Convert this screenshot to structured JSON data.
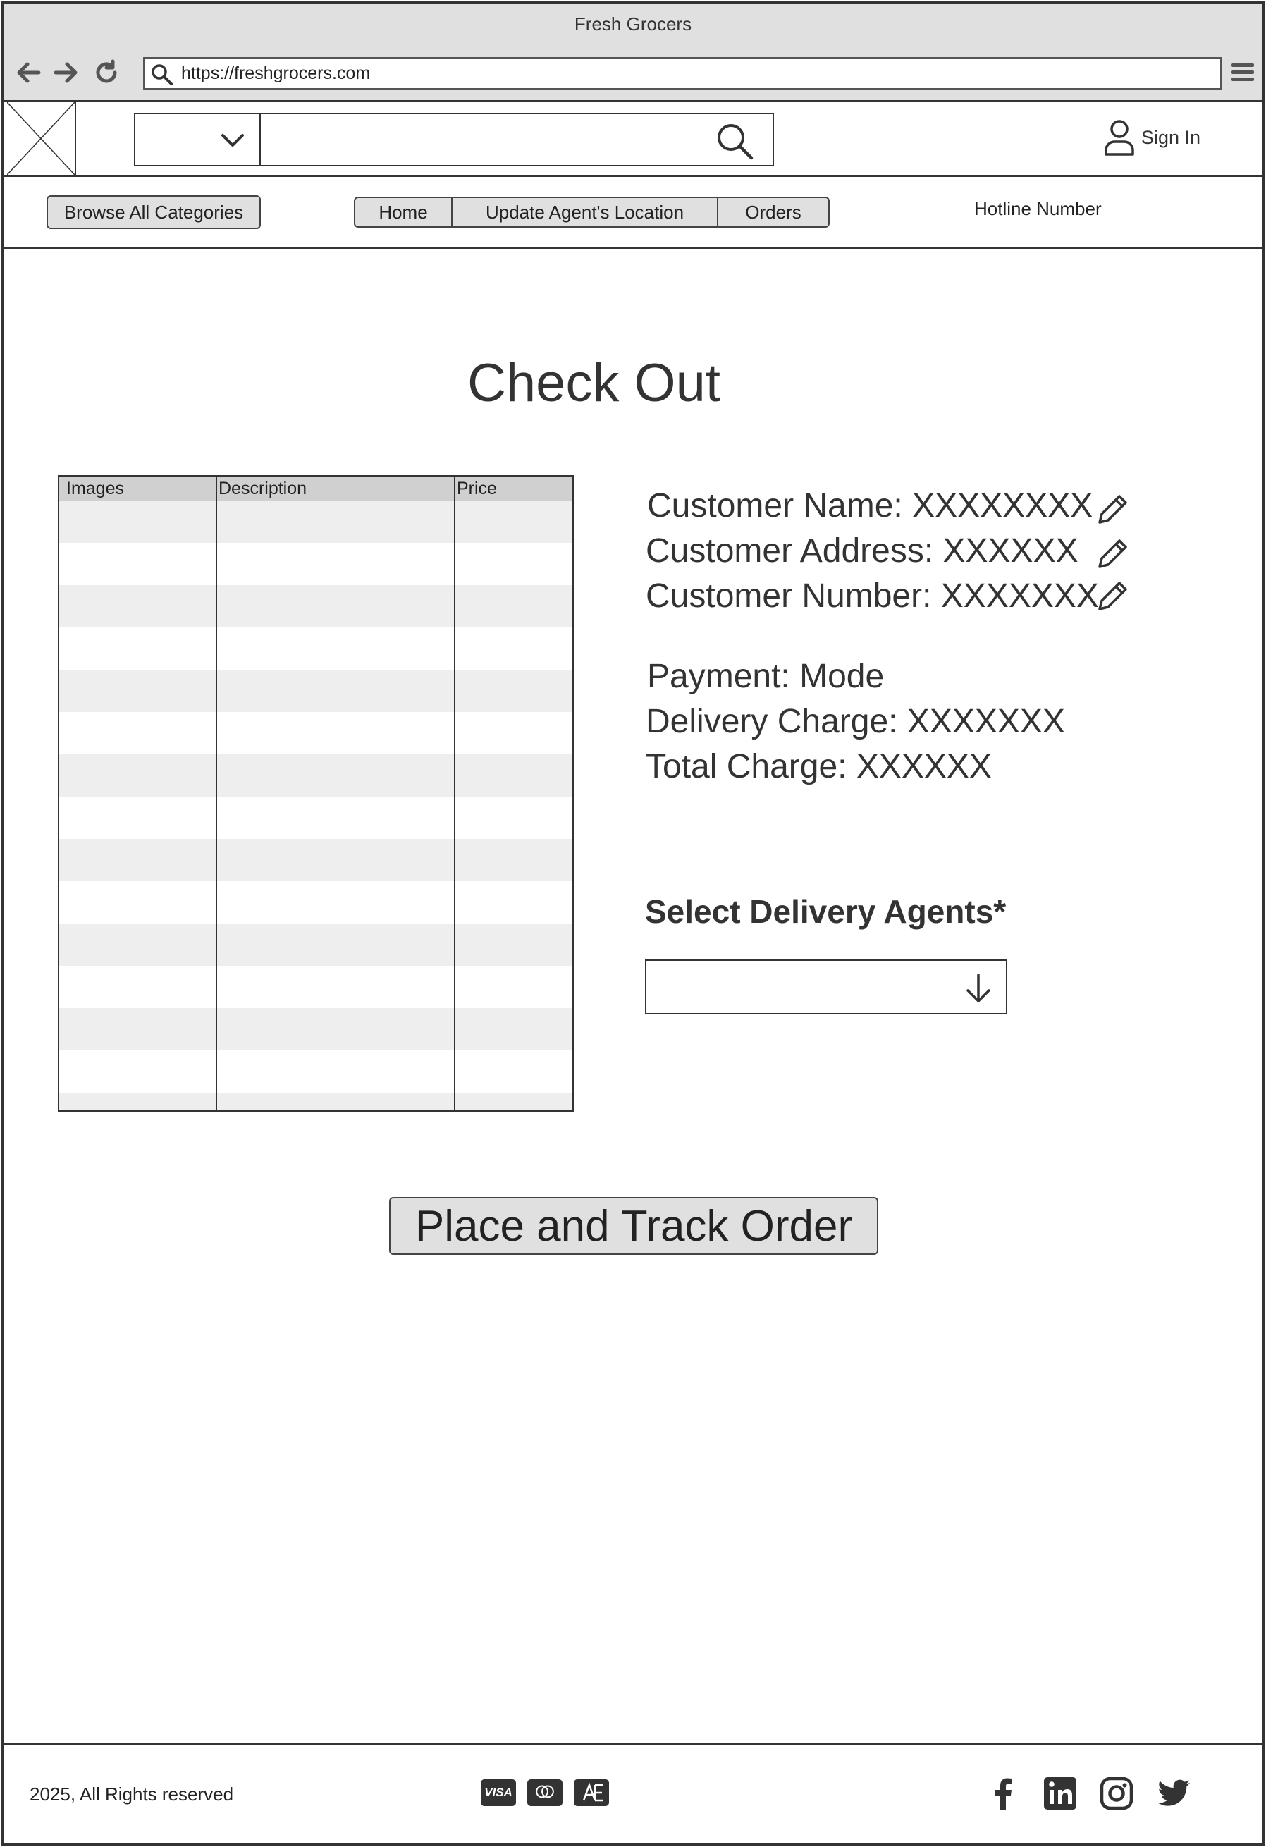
{
  "window": {
    "title": "Fresh Grocers",
    "url": "https://freshgrocers.com"
  },
  "header": {
    "search_placeholder": "",
    "sign_in_label": "Sign In"
  },
  "nav": {
    "browse_label": "Browse All Categories",
    "tabs": [
      {
        "label": "Home"
      },
      {
        "label": "Update Agent's Location"
      },
      {
        "label": "Orders"
      }
    ],
    "hotline_label": "Hotline Number"
  },
  "checkout": {
    "title": "Check Out",
    "table": {
      "headers": [
        "Images",
        "Description",
        "Price"
      ]
    },
    "customer": {
      "name_line": "Customer Name: XXXXXXXX",
      "address_line": "Customer Address: XXXXXX",
      "number_line": "Customer Number: XXXXXXX"
    },
    "summary": {
      "payment_line": "Payment: Mode",
      "delivery_line": "Delivery Charge: XXXXXXX",
      "total_line": "Total Charge: XXXXXX"
    },
    "agents_label": "Select Delivery Agents*",
    "place_order_label": "Place and Track Order"
  },
  "footer": {
    "copyright": "2025, All Rights reserved",
    "payment_icons": [
      "visa-icon",
      "mastercard-icon",
      "amex-icon"
    ],
    "social_icons": [
      "facebook-icon",
      "linkedin-icon",
      "instagram-icon",
      "twitter-icon"
    ]
  }
}
